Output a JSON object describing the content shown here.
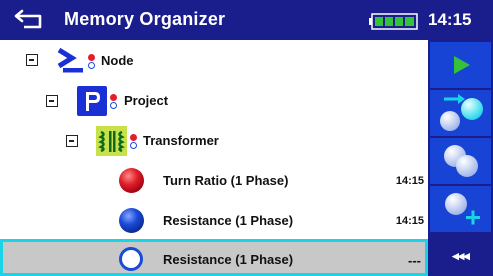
{
  "header": {
    "title": "Memory Organizer",
    "time": "14:15"
  },
  "tree": {
    "node": {
      "label": "Node"
    },
    "project": {
      "label": "Project"
    },
    "transformer": {
      "label": "Transformer"
    },
    "measurements": [
      {
        "label": "Turn Ratio (1 Phase)",
        "time": "14:15",
        "status": "fail"
      },
      {
        "label": "Resistance (1 Phase)",
        "time": "14:15",
        "status": "pass"
      },
      {
        "label": "Resistance (1 Phase)",
        "time": "---",
        "status": "empty"
      }
    ]
  },
  "toolbar": {
    "more_label": "◂◂◂"
  },
  "colors": {
    "header_bg": "#1a1d8c",
    "button_bg": "#1744d4",
    "selection_border": "#19d3e8",
    "selection_bg": "#c8c8c8",
    "fail": "#e0202a",
    "pass": "#1a4bd8",
    "start": "#35c23a"
  }
}
